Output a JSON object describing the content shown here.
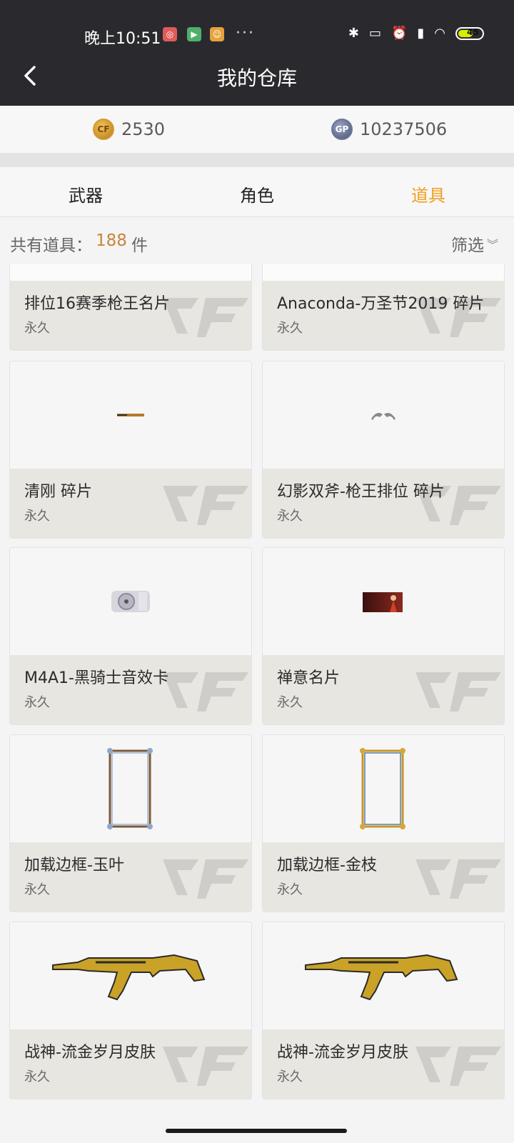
{
  "status": {
    "time": "晚上10:51",
    "dots": "···",
    "battery": "45"
  },
  "header": {
    "title": "我的仓库"
  },
  "currency": {
    "cf_points": "2530",
    "gp_points": "10237506",
    "gp_badge": "GP"
  },
  "tabs": [
    {
      "label": "武器"
    },
    {
      "label": "角色"
    },
    {
      "label": "道具",
      "active": true
    }
  ],
  "summary": {
    "label": "共有道具：",
    "count": "188",
    "unit": "件",
    "filter": "筛选"
  },
  "items": [
    {
      "name": "排位16赛季枪王名片",
      "duration": "永久",
      "icon": "name-card"
    },
    {
      "name": "Anaconda-万圣节2019 碎片",
      "duration": "永久",
      "icon": "fragment"
    },
    {
      "name": "清刚 碎片",
      "duration": "永久",
      "icon": "knife-fragment"
    },
    {
      "name": "幻影双斧-枪王排位 碎片",
      "duration": "永久",
      "icon": "axe-fragment"
    },
    {
      "name": "M4A1-黑骑士音效卡",
      "duration": "永久",
      "icon": "sound-card"
    },
    {
      "name": "禅意名片",
      "duration": "永久",
      "icon": "name-card"
    },
    {
      "name": "加载边框-玉叶",
      "duration": "永久",
      "icon": "frame"
    },
    {
      "name": "加载边框-金枝",
      "duration": "永久",
      "icon": "frame"
    },
    {
      "name": "战神-流金岁月皮肤",
      "duration": "永久",
      "icon": "rifle-skin"
    },
    {
      "name": "战神-流金岁月皮肤",
      "duration": "永久",
      "icon": "rifle-skin"
    }
  ],
  "colors": {
    "header_bg": "#2a2a2e",
    "accent": "#f0a020",
    "count": "#c8843a"
  }
}
